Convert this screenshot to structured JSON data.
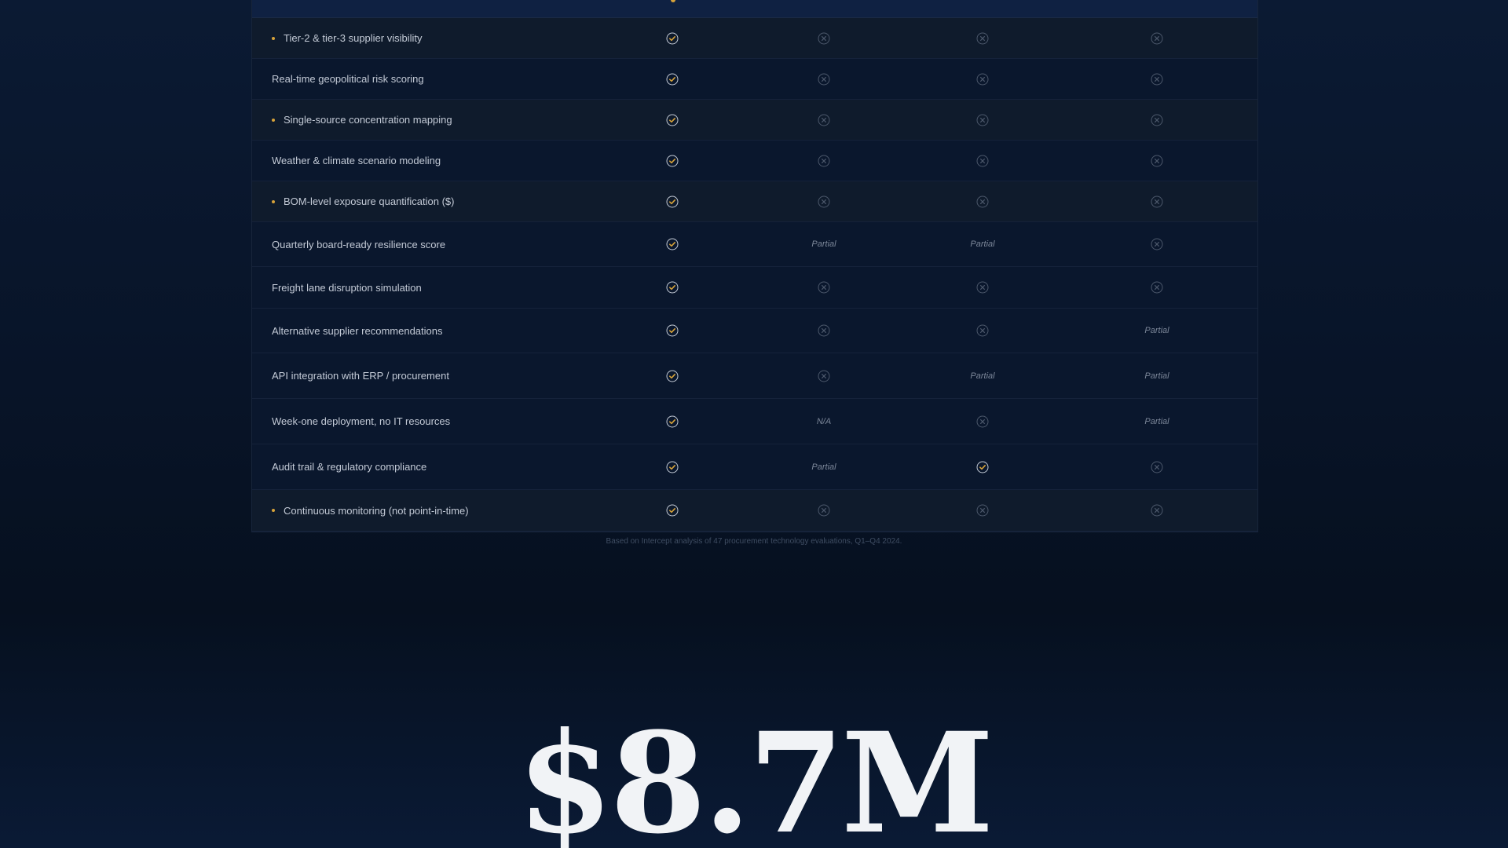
{
  "comparison": {
    "rows": [
      {
        "feature": "Tier-2 & tier-3 supplier visibility",
        "highlight": true,
        "cells": [
          "check",
          "x",
          "x",
          "x"
        ]
      },
      {
        "feature": "Real-time geopolitical risk scoring",
        "highlight": false,
        "cells": [
          "check",
          "x",
          "x",
          "x"
        ]
      },
      {
        "feature": "Single-source concentration mapping",
        "highlight": true,
        "cells": [
          "check",
          "x",
          "x",
          "x"
        ]
      },
      {
        "feature": "Weather & climate scenario modeling",
        "highlight": false,
        "cells": [
          "check",
          "x",
          "x",
          "x"
        ]
      },
      {
        "feature": "BOM-level exposure quantification ($)",
        "highlight": true,
        "cells": [
          "check",
          "x",
          "x",
          "x"
        ]
      },
      {
        "feature": "Quarterly board-ready resilience score",
        "highlight": false,
        "cells": [
          "check",
          "Partial",
          "Partial",
          "x"
        ]
      },
      {
        "feature": "Freight lane disruption simulation",
        "highlight": false,
        "cells": [
          "check",
          "x",
          "x",
          "x"
        ]
      },
      {
        "feature": "Alternative supplier recommendations",
        "highlight": false,
        "cells": [
          "check",
          "x",
          "x",
          "Partial"
        ]
      },
      {
        "feature": "API integration with ERP / procurement",
        "highlight": false,
        "cells": [
          "check",
          "x",
          "Partial",
          "Partial"
        ]
      },
      {
        "feature": "Week-one deployment, no IT resources",
        "highlight": false,
        "cells": [
          "check",
          "N/A",
          "x",
          "Partial"
        ]
      },
      {
        "feature": "Audit trail & regulatory compliance",
        "highlight": false,
        "cells": [
          "check",
          "Partial",
          "check",
          "x"
        ]
      },
      {
        "feature": "Continuous monitoring (not point-in-time)",
        "highlight": true,
        "cells": [
          "check",
          "x",
          "x",
          "x"
        ]
      }
    ],
    "footnote": "Based on Intercept analysis of 47 procurement technology evaluations, Q1–Q4 2024."
  },
  "stat": {
    "value": "$8.7M"
  },
  "colors": {
    "accent": "#d6a23a",
    "check_icon": "check-icon",
    "x_icon": "x-circle-icon"
  }
}
